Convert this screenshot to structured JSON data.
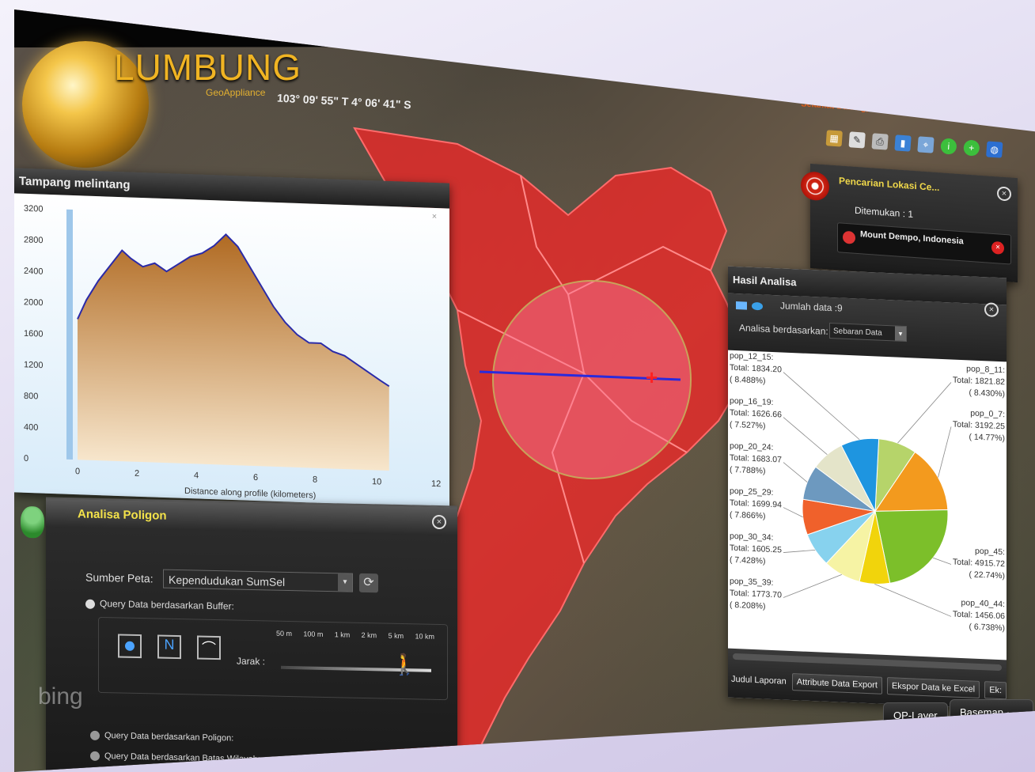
{
  "header": {
    "app_title": "LUMBUNG",
    "app_subtitle": "GeoAppliance",
    "coordinates": "103° 09' 55\" T 4° 06' 41\" S",
    "welcome": "Selamat Datang, administrator!  Beranda  Logout",
    "tools": [
      "layers-icon",
      "edit-icon",
      "print-icon",
      "chart-icon",
      "pin-icon",
      "info-icon",
      "add-icon",
      "globe-icon"
    ]
  },
  "profile_panel": {
    "title": "Tampang melintang",
    "xlabel": "Distance along profile (kilometers)",
    "close": "×"
  },
  "chart_data": [
    {
      "type": "area",
      "title": "",
      "xlabel": "Distance along profile (kilometers)",
      "ylabel": "",
      "xlim": [
        0,
        12
      ],
      "ylim": [
        0,
        3200
      ],
      "x_ticks": [
        0,
        2,
        4,
        6,
        8,
        10,
        12
      ],
      "y_ticks": [
        0,
        400,
        800,
        1200,
        1600,
        2000,
        2400,
        2800,
        3200
      ],
      "x": [
        0,
        0.3,
        0.7,
        1.1,
        1.5,
        1.8,
        2.2,
        2.6,
        3.0,
        3.4,
        3.8,
        4.2,
        4.6,
        5.0,
        5.4,
        5.8,
        6.2,
        6.6,
        7.0,
        7.4,
        7.8,
        8.2,
        8.6,
        9.0,
        9.4,
        9.8,
        10.2,
        10.5
      ],
      "y": [
        1800,
        2050,
        2300,
        2500,
        2700,
        2600,
        2500,
        2550,
        2450,
        2550,
        2650,
        2700,
        2800,
        2950,
        2800,
        2550,
        2300,
        2050,
        1850,
        1700,
        1600,
        1600,
        1500,
        1450,
        1350,
        1250,
        1150,
        1080
      ]
    },
    {
      "type": "pie",
      "title": "",
      "slices": [
        {
          "label": "pop_8_11",
          "value": 1821.82,
          "percent": "8.430%",
          "color": "#b6d46a"
        },
        {
          "label": "pop_0_7",
          "value": 3192.25,
          "percent": "14.77%",
          "color": "#f39a1e"
        },
        {
          "label": "pop_45",
          "value": 4915.72,
          "percent": "22.74%",
          "color": "#7cbf2a"
        },
        {
          "label": "pop_40_44",
          "value": 1456.06,
          "percent": "6.738%",
          "color": "#f1d40c"
        },
        {
          "label": "pop_35_39",
          "value": 1773.7,
          "percent": "8.208%",
          "color": "#f6f3a4"
        },
        {
          "label": "pop_30_34",
          "value": 1605.25,
          "percent": "7.428%",
          "color": "#87d2ee"
        },
        {
          "label": "pop_25_29",
          "value": 1699.94,
          "percent": "7.866%",
          "color": "#f0612b"
        },
        {
          "label": "pop_20_24",
          "value": 1683.07,
          "percent": "7.788%",
          "color": "#6d99bf"
        },
        {
          "label": "pop_16_19",
          "value": 1626.66,
          "percent": "7.527%",
          "color": "#e4e4c9"
        },
        {
          "label": "pop_12_15",
          "value": 1834.2,
          "percent": "8.488%",
          "color": "#1e95e0"
        }
      ]
    }
  ],
  "pie_labels": {
    "pop_12_15": [
      "pop_12_15:",
      "Total: 1834.20",
      "( 8.488%)"
    ],
    "pop_16_19": [
      "pop_16_19:",
      "Total: 1626.66",
      "( 7.527%)"
    ],
    "pop_20_24": [
      "pop_20_24:",
      "Total: 1683.07",
      "( 7.788%)"
    ],
    "pop_25_29": [
      "pop_25_29:",
      "Total: 1699.94",
      "( 7.866%)"
    ],
    "pop_30_34": [
      "pop_30_34:",
      "Total: 1605.25",
      "( 7.428%)"
    ],
    "pop_35_39": [
      "pop_35_39:",
      "Total: 1773.70",
      "( 8.208%)"
    ],
    "pop_8_11": [
      "pop_8_11:",
      "Total: 1821.82",
      "( 8.430%)"
    ],
    "pop_0_7": [
      "pop_0_7:",
      "Total: 3192.25",
      "( 14.77%)"
    ],
    "pop_45": [
      "pop_45:",
      "Total: 4915.72",
      "( 22.74%)"
    ],
    "pop_40_44": [
      "pop_40_44:",
      "Total: 1456.06",
      "( 6.738%)"
    ]
  },
  "search_panel": {
    "title": "Pencarian Lokasi Ce...",
    "found": "Ditemukan : 1",
    "result": "Mount Dempo, Indonesia"
  },
  "hasil_panel": {
    "title": "Hasil Analisa",
    "count": "Jumlah data :9",
    "analysis_label": "Analisa berdasarkan:",
    "analysis_value": "Sebaran Data",
    "report_label": "Judul Laporan",
    "btn_attr": "Attribute Data Export",
    "btn_excel": "Ekspor Data ke Excel",
    "btn_more": "Ek:"
  },
  "poly_panel": {
    "title": "Analisa Poligon",
    "source_label": "Sumber Peta:",
    "source_value": "Kependudukan SumSel",
    "opt_buffer": "Query Data berdasarkan Buffer:",
    "distance_label": "Jarak :",
    "scale": [
      "50 m",
      "100 m",
      "1 km",
      "2 km",
      "5 km",
      "10 km"
    ],
    "opt_polygon": "Query Data berdasarkan Poligon:",
    "opt_boundary": "Query Data berdasarkan Batas Wilayah:"
  },
  "map": {
    "bing": "bing",
    "btn_layer": "OP-Layer",
    "btn_basemap": "Basemap"
  }
}
